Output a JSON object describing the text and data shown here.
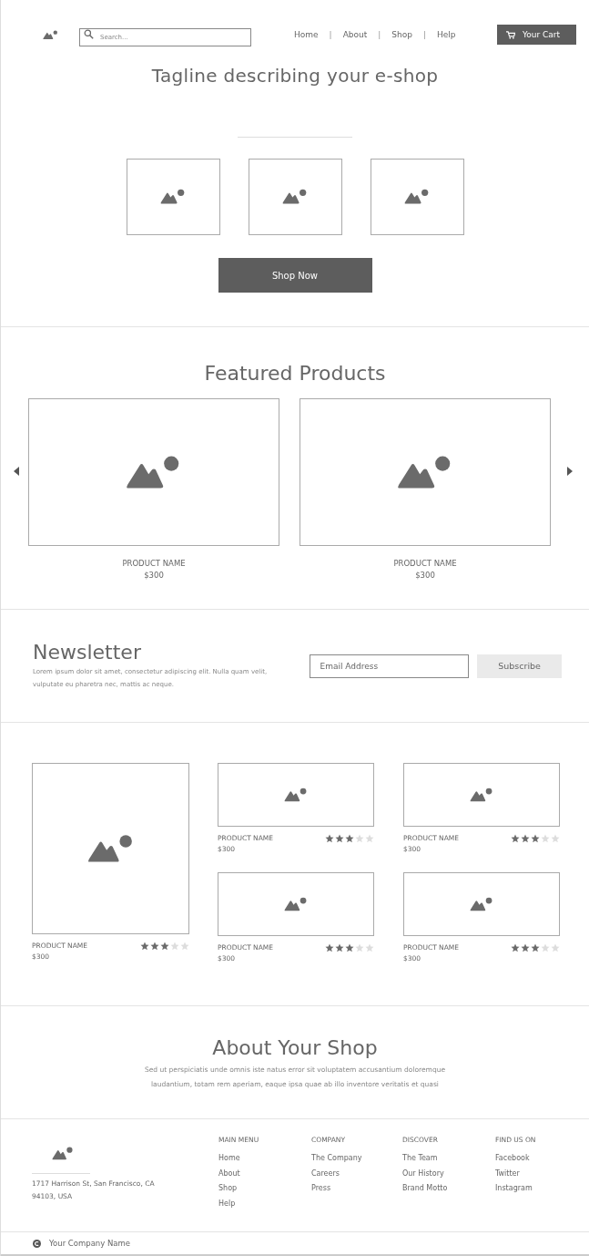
{
  "header": {
    "search": {
      "placeholder": "Search..."
    },
    "nav": [
      {
        "label": "Home"
      },
      {
        "label": "About"
      },
      {
        "label": "Shop"
      },
      {
        "label": "Help"
      }
    ],
    "separator": "|",
    "cart_button": "Your Cart"
  },
  "hero": {
    "tagline": "Tagline describing your e-shop",
    "button": "Shop Now"
  },
  "featured": {
    "title": "Featured Products",
    "products": [
      {
        "name": "PRODUCT NAME",
        "price": "$300"
      },
      {
        "name": "PRODUCT NAME",
        "price": "$300"
      }
    ]
  },
  "newsletter": {
    "title": "Newsletter",
    "text": "Lorem ipsum dolor sit amet, consectetur adipiscing elit. Nulla quam velit, vulputate eu pharetra nec, mattis ac neque.",
    "email": {
      "placeholder": "Email Address"
    },
    "button": "Subscribe"
  },
  "grid": {
    "large": {
      "name": "PRODUCT NAME",
      "price": "$300",
      "stars": 3
    },
    "small": [
      {
        "name": "PRODUCT NAME",
        "price": "$300",
        "stars": 3
      },
      {
        "name": "PRODUCT NAME",
        "price": "$300",
        "stars": 3
      },
      {
        "name": "PRODUCT NAME",
        "price": "$300",
        "stars": 3
      },
      {
        "name": "PRODUCT NAME",
        "price": "$300",
        "stars": 3
      }
    ]
  },
  "about": {
    "title": "About Your Shop",
    "text": "Sed ut perspiciatis unde omnis iste natus error sit voluptatem accusantium doloremque laudantium, totam rem aperiam, eaque ipsa quae ab illo inventore veritatis et quasi"
  },
  "footer": {
    "address": "1717 Harrison St, San Francisco, CA 94103, USA",
    "columns": [
      {
        "heading": "MAIN MENU",
        "links": [
          "Home",
          "About",
          "Shop",
          "Help"
        ]
      },
      {
        "heading": "COMPANY",
        "links": [
          "The Company",
          "Careers",
          "Press"
        ]
      },
      {
        "heading": "DISCOVER",
        "links": [
          "The Team",
          "Our History",
          "Brand Motto"
        ]
      },
      {
        "heading": "FIND US ON",
        "links": [
          "Facebook",
          "Twitter",
          "Instagram"
        ]
      }
    ],
    "company": "Your Company Name"
  }
}
